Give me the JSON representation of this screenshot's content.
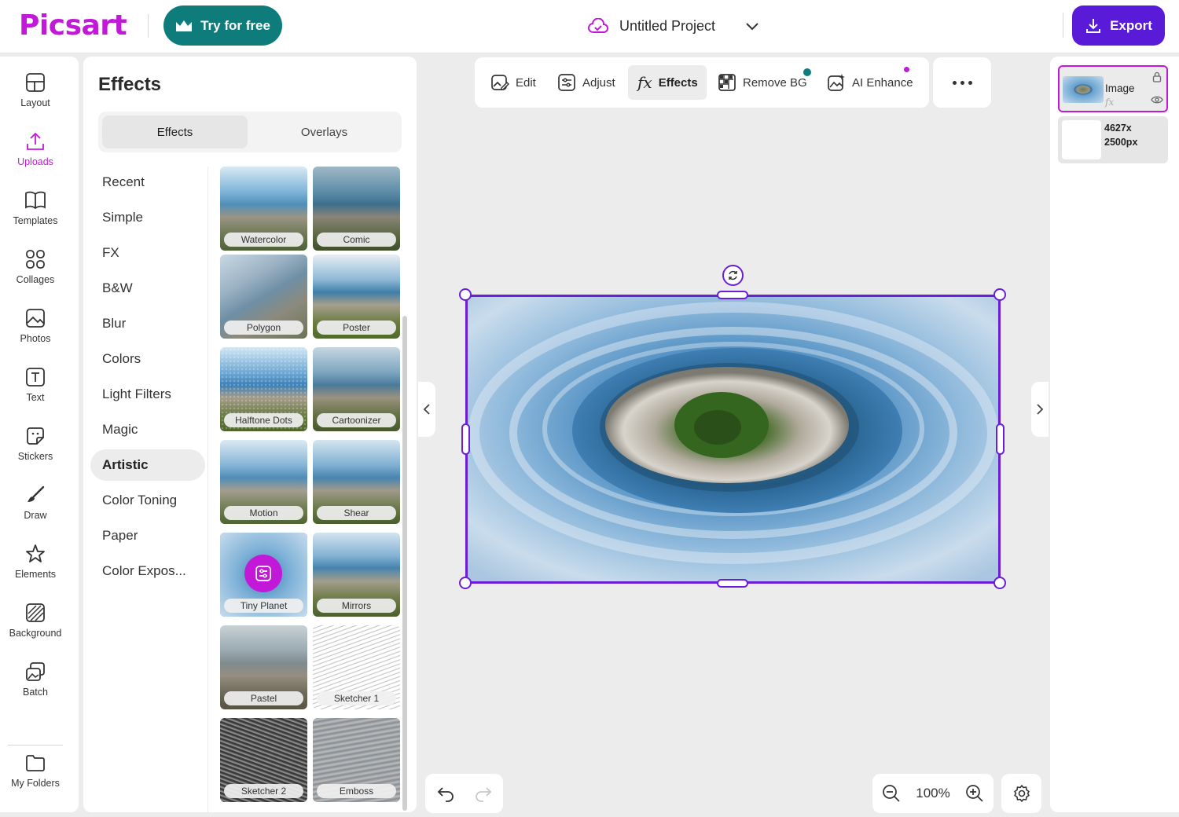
{
  "app": {
    "logo": "Picsart"
  },
  "header": {
    "try_label": "Try for free",
    "project_title": "Untitled Project",
    "export_label": "Export"
  },
  "rail": {
    "items": [
      {
        "label": "Layout",
        "icon": "layout-icon"
      },
      {
        "label": "Uploads",
        "icon": "upload-icon",
        "active": true
      },
      {
        "label": "Templates",
        "icon": "templates-icon"
      },
      {
        "label": "Collages",
        "icon": "collages-icon"
      },
      {
        "label": "Photos",
        "icon": "photos-icon"
      },
      {
        "label": "Text",
        "icon": "text-icon"
      },
      {
        "label": "Stickers",
        "icon": "stickers-icon"
      },
      {
        "label": "Draw",
        "icon": "brush-icon"
      },
      {
        "label": "Elements",
        "icon": "star-icon"
      },
      {
        "label": "Background",
        "icon": "background-icon"
      },
      {
        "label": "Batch",
        "icon": "batch-icon"
      }
    ],
    "folders_label": "My Folders"
  },
  "effects_panel": {
    "title": "Effects",
    "tabs": [
      {
        "label": "Effects",
        "active": true
      },
      {
        "label": "Overlays"
      }
    ],
    "categories": [
      {
        "label": "Recent"
      },
      {
        "label": "Simple"
      },
      {
        "label": "FX"
      },
      {
        "label": "B&W"
      },
      {
        "label": "Blur"
      },
      {
        "label": "Colors"
      },
      {
        "label": "Light Filters"
      },
      {
        "label": "Magic"
      },
      {
        "label": "Artistic",
        "active": true
      },
      {
        "label": "Color Toning"
      },
      {
        "label": "Paper"
      },
      {
        "label": "Color Expos..."
      }
    ],
    "thumbnails": [
      {
        "label": "Watercolor"
      },
      {
        "label": "Comic"
      },
      {
        "label": "Polygon"
      },
      {
        "label": "Poster"
      },
      {
        "label": "Halftone Dots"
      },
      {
        "label": "Cartoonizer"
      },
      {
        "label": "Motion"
      },
      {
        "label": "Shear"
      },
      {
        "label": "Tiny Planet",
        "selected": true
      },
      {
        "label": "Mirrors"
      },
      {
        "label": "Pastel"
      },
      {
        "label": "Sketcher 1"
      },
      {
        "label": "Sketcher 2"
      },
      {
        "label": "Emboss"
      }
    ]
  },
  "toolbar": {
    "tools": [
      {
        "label": "Edit",
        "icon": "edit-image-icon"
      },
      {
        "label": "Adjust",
        "icon": "adjust-icon"
      },
      {
        "label": "Effects",
        "icon": "fx-icon",
        "active": true
      },
      {
        "label": "Remove BG",
        "icon": "remove-bg-icon"
      },
      {
        "label": "AI Enhance",
        "icon": "ai-enhance-icon"
      }
    ]
  },
  "zoom": {
    "level": "100%"
  },
  "layers": {
    "image_layer": {
      "name": "Image",
      "fx": "fx"
    },
    "background_layer": {
      "dims_line1": "4627x",
      "dims_line2": "2500px"
    }
  },
  "colors": {
    "brand": "#c219d9",
    "accent": "#5a1bd9",
    "teal": "#0f7c7c",
    "selection": "#6a1fd6"
  }
}
